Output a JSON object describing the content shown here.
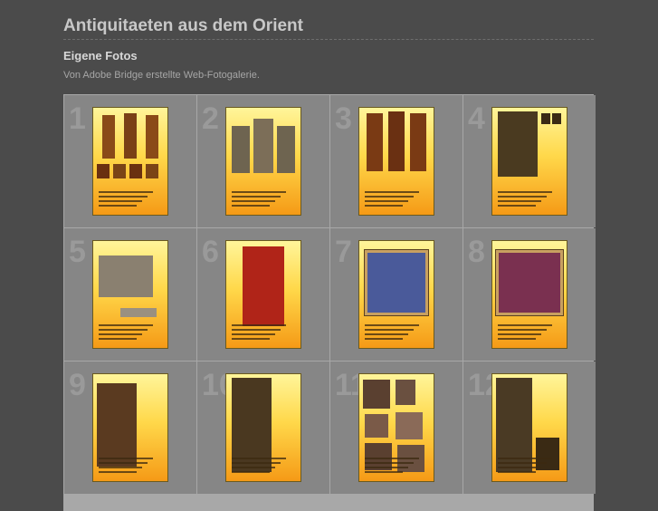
{
  "page": {
    "title": "Antiquitaeten aus dem Orient",
    "subtitle": "Eigene Fotos",
    "description": "Von Adobe Bridge erstellte Web-Fotogalerie."
  },
  "gallery": {
    "thumbnails": [
      {
        "number": "1",
        "heading": "Buddha Gruppe aus China"
      },
      {
        "number": "2",
        "heading": "Buddha Gruppe aus Tibet"
      },
      {
        "number": "3",
        "heading": "Buddha Gruppe aus Nepal"
      },
      {
        "number": "4",
        "heading": "1000-Arm Guan Ying"
      },
      {
        "number": "5",
        "heading": "Chinesische Rikscha"
      },
      {
        "number": "6",
        "heading": "Hochzeitssänfte"
      },
      {
        "number": "7",
        "heading": "Seidenbild"
      },
      {
        "number": "8",
        "heading": "Seidenbild"
      },
      {
        "number": "9",
        "heading": "Guan Ying"
      },
      {
        "number": "10",
        "heading": "Guan Ying"
      },
      {
        "number": "11",
        "heading": "Guan Ying"
      },
      {
        "number": "12",
        "heading": "Holzfiguren"
      }
    ]
  }
}
